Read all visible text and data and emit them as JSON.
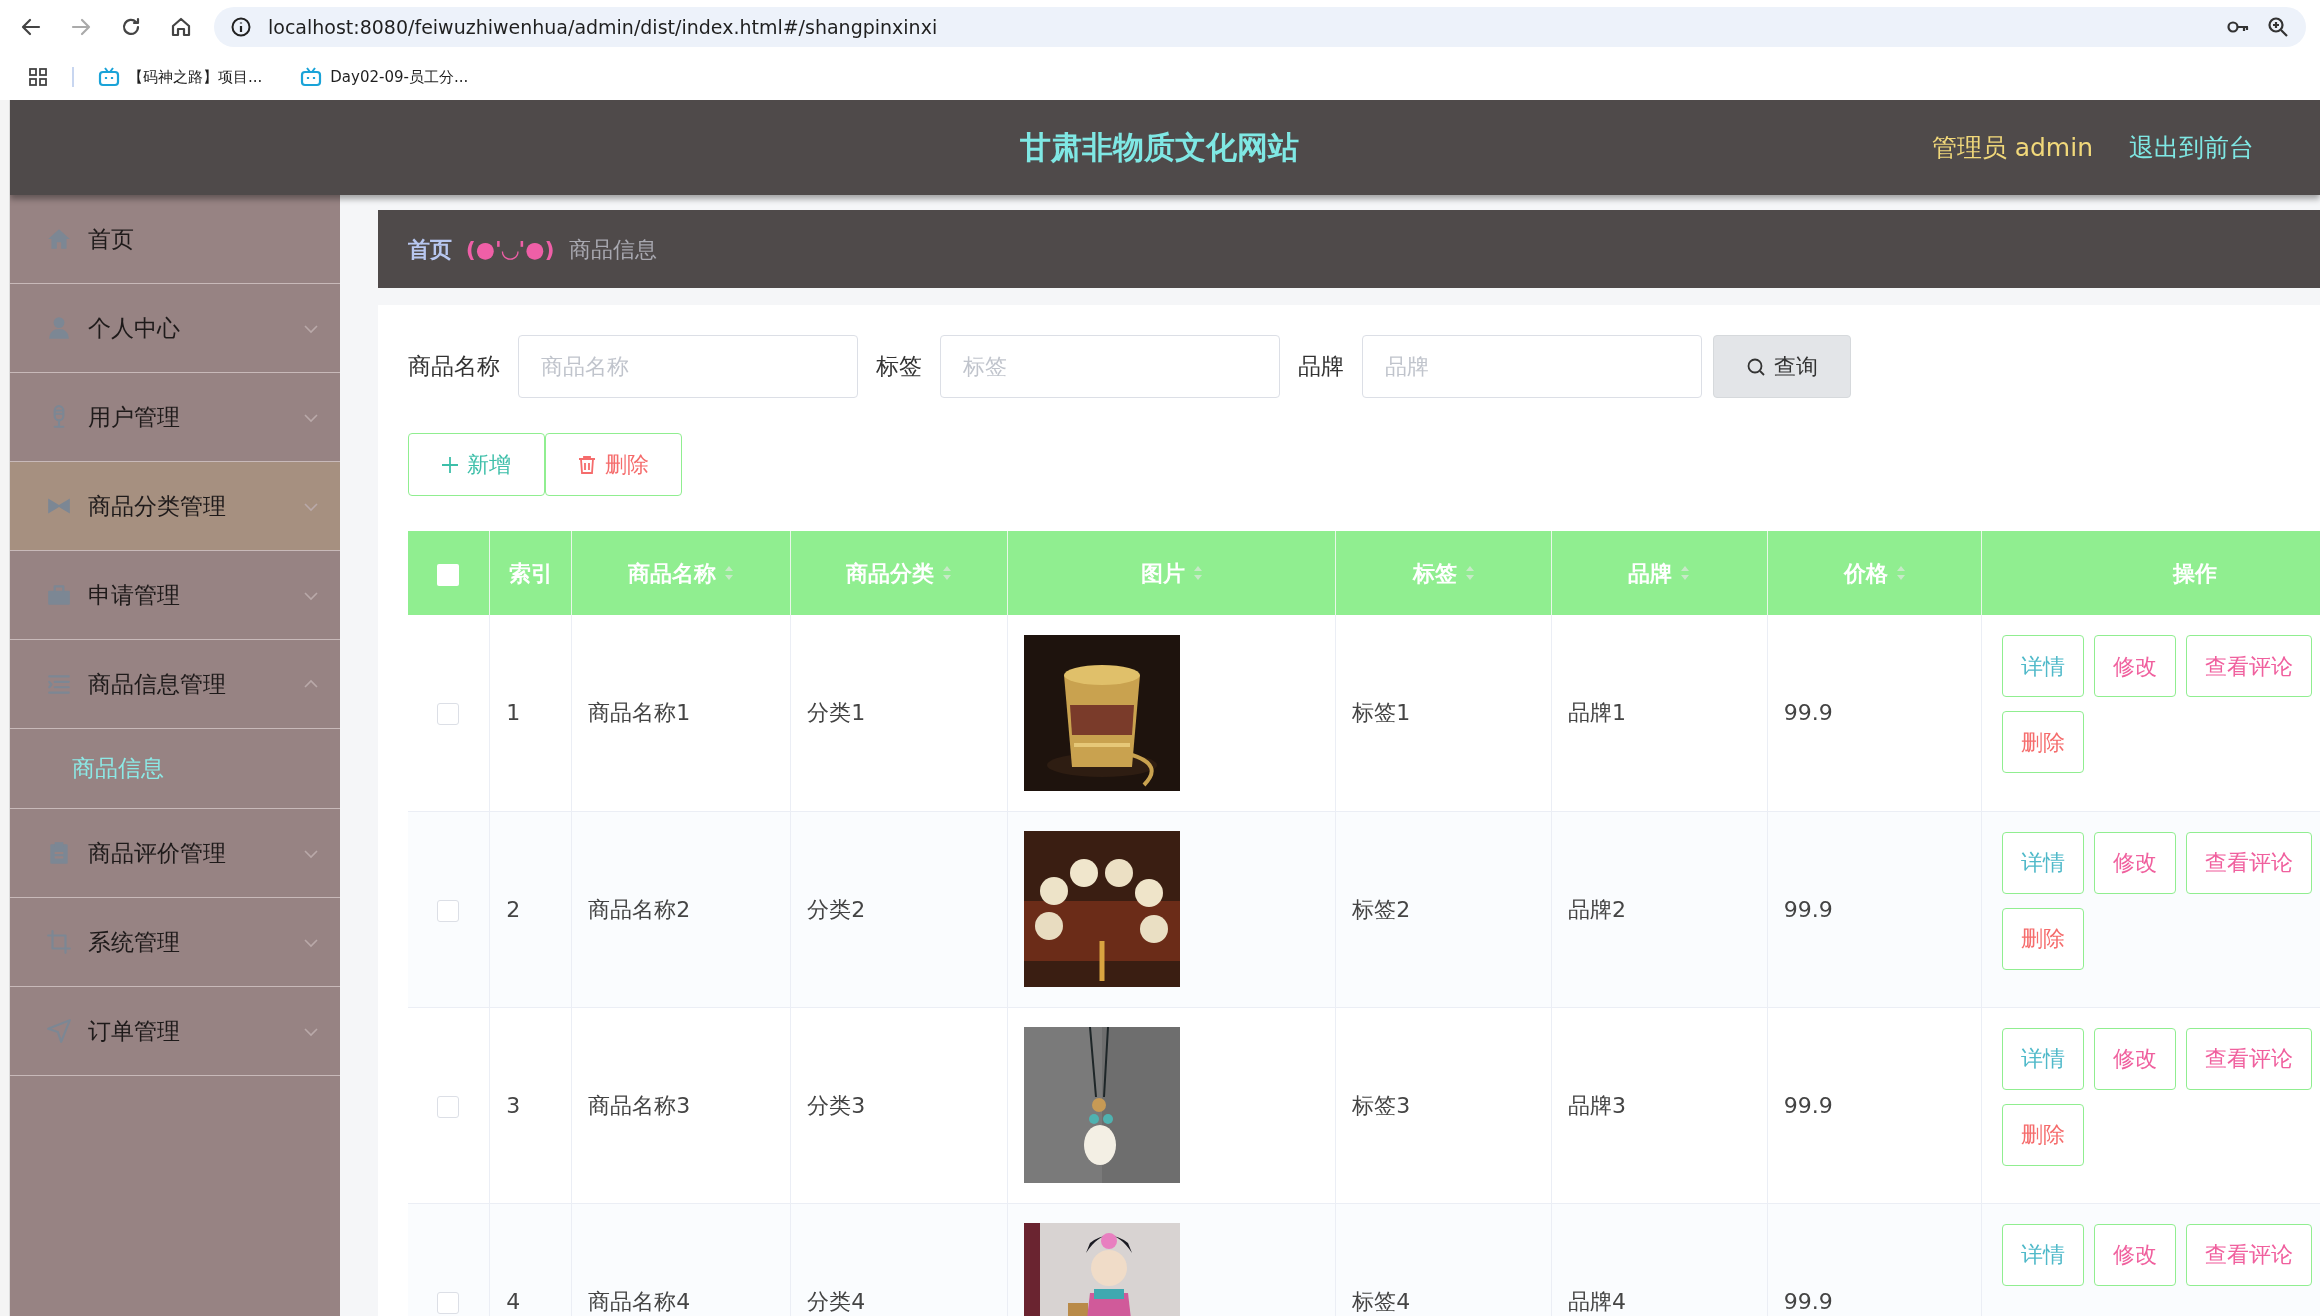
{
  "browser": {
    "url": "localhost:8080/feiwuzhiwenhua/admin/dist/index.html#/shangpinxinxi",
    "forward_disabled": true,
    "bookmarks": [
      {
        "label": "【码神之路】项目..."
      },
      {
        "label": "Day02-09-员工分..."
      }
    ]
  },
  "header": {
    "title": "甘肃非物质文化网站",
    "user": "管理员 admin",
    "links": [
      "退出到前台"
    ]
  },
  "sidebar": {
    "items": [
      {
        "label": "首页",
        "kind": "link",
        "hovered": false
      },
      {
        "label": "个人中心",
        "kind": "menu",
        "expanded": false,
        "hovered": false
      },
      {
        "label": "用户管理",
        "kind": "menu",
        "expanded": false,
        "hovered": false
      },
      {
        "label": "商品分类管理",
        "kind": "menu",
        "expanded": false,
        "hovered": true
      },
      {
        "label": "申请管理",
        "kind": "menu",
        "expanded": false,
        "hovered": false
      },
      {
        "label": "商品信息管理",
        "kind": "menu",
        "expanded": true,
        "hovered": false,
        "children": [
          {
            "label": "商品信息",
            "selected": true
          }
        ]
      },
      {
        "label": "商品评价管理",
        "kind": "menu",
        "expanded": false,
        "hovered": false
      },
      {
        "label": "系统管理",
        "kind": "menu",
        "expanded": false,
        "hovered": false
      },
      {
        "label": "订单管理",
        "kind": "menu",
        "expanded": false,
        "hovered": false
      }
    ]
  },
  "breadcrumb": {
    "home": "首页",
    "separator": "(●'◡'●)",
    "current": "商品信息"
  },
  "search": {
    "fields": [
      {
        "label": "商品名称",
        "placeholder": "商品名称"
      },
      {
        "label": "标签",
        "placeholder": "标签"
      },
      {
        "label": "品牌",
        "placeholder": "品牌"
      }
    ],
    "button": "查询"
  },
  "actions": [
    {
      "label": "新增",
      "kind": "add"
    },
    {
      "label": "删除",
      "kind": "delete"
    }
  ],
  "table": {
    "select_all_checked": false,
    "columns": [
      {
        "kind": "checkbox"
      },
      {
        "kind": "text",
        "label": "索引",
        "sortable": false
      },
      {
        "kind": "text",
        "label": "商品名称",
        "sortable": true
      },
      {
        "kind": "text",
        "label": "商品分类",
        "sortable": true
      },
      {
        "kind": "text",
        "label": "图片",
        "sortable": true
      },
      {
        "kind": "text",
        "label": "标签",
        "sortable": true
      },
      {
        "kind": "text",
        "label": "品牌",
        "sortable": true
      },
      {
        "kind": "text",
        "label": "价格",
        "sortable": true
      },
      {
        "kind": "text",
        "label": "操作",
        "sortable": false
      }
    ],
    "rows": [
      {
        "selected": false,
        "index": "1",
        "name": "商品名称1",
        "category": "分类1",
        "picture": {
          "kind": "picture"
        },
        "tag": "标签1",
        "brand": "品牌1",
        "price": "99.9",
        "buttons": [
          {
            "label": "详情",
            "kind": "detail"
          },
          {
            "label": "修改",
            "kind": "edit"
          },
          {
            "label": "查看评论",
            "kind": "edit"
          },
          {
            "label": "删除",
            "kind": "delete"
          }
        ]
      },
      {
        "selected": false,
        "index": "2",
        "name": "商品名称2",
        "category": "分类2",
        "picture": {
          "kind": "picture"
        },
        "tag": "标签2",
        "brand": "品牌2",
        "price": "99.9",
        "buttons": [
          {
            "label": "详情",
            "kind": "detail"
          },
          {
            "label": "修改",
            "kind": "edit"
          },
          {
            "label": "查看评论",
            "kind": "edit"
          },
          {
            "label": "删除",
            "kind": "delete"
          }
        ]
      },
      {
        "selected": false,
        "index": "3",
        "name": "商品名称3",
        "category": "分类3",
        "picture": {
          "kind": "picture"
        },
        "tag": "标签3",
        "brand": "品牌3",
        "price": "99.9",
        "buttons": [
          {
            "label": "详情",
            "kind": "detail"
          },
          {
            "label": "修改",
            "kind": "edit"
          },
          {
            "label": "查看评论",
            "kind": "edit"
          },
          {
            "label": "删除",
            "kind": "delete"
          }
        ]
      },
      {
        "selected": false,
        "index": "4",
        "name": "商品名称4",
        "category": "分类4",
        "picture": {
          "kind": "picture"
        },
        "tag": "标签4",
        "brand": "品牌4",
        "price": "99.9",
        "buttons": [
          {
            "label": "详情",
            "kind": "detail"
          },
          {
            "label": "修改",
            "kind": "edit"
          },
          {
            "label": "查看评论",
            "kind": "edit"
          }
        ]
      }
    ]
  }
}
